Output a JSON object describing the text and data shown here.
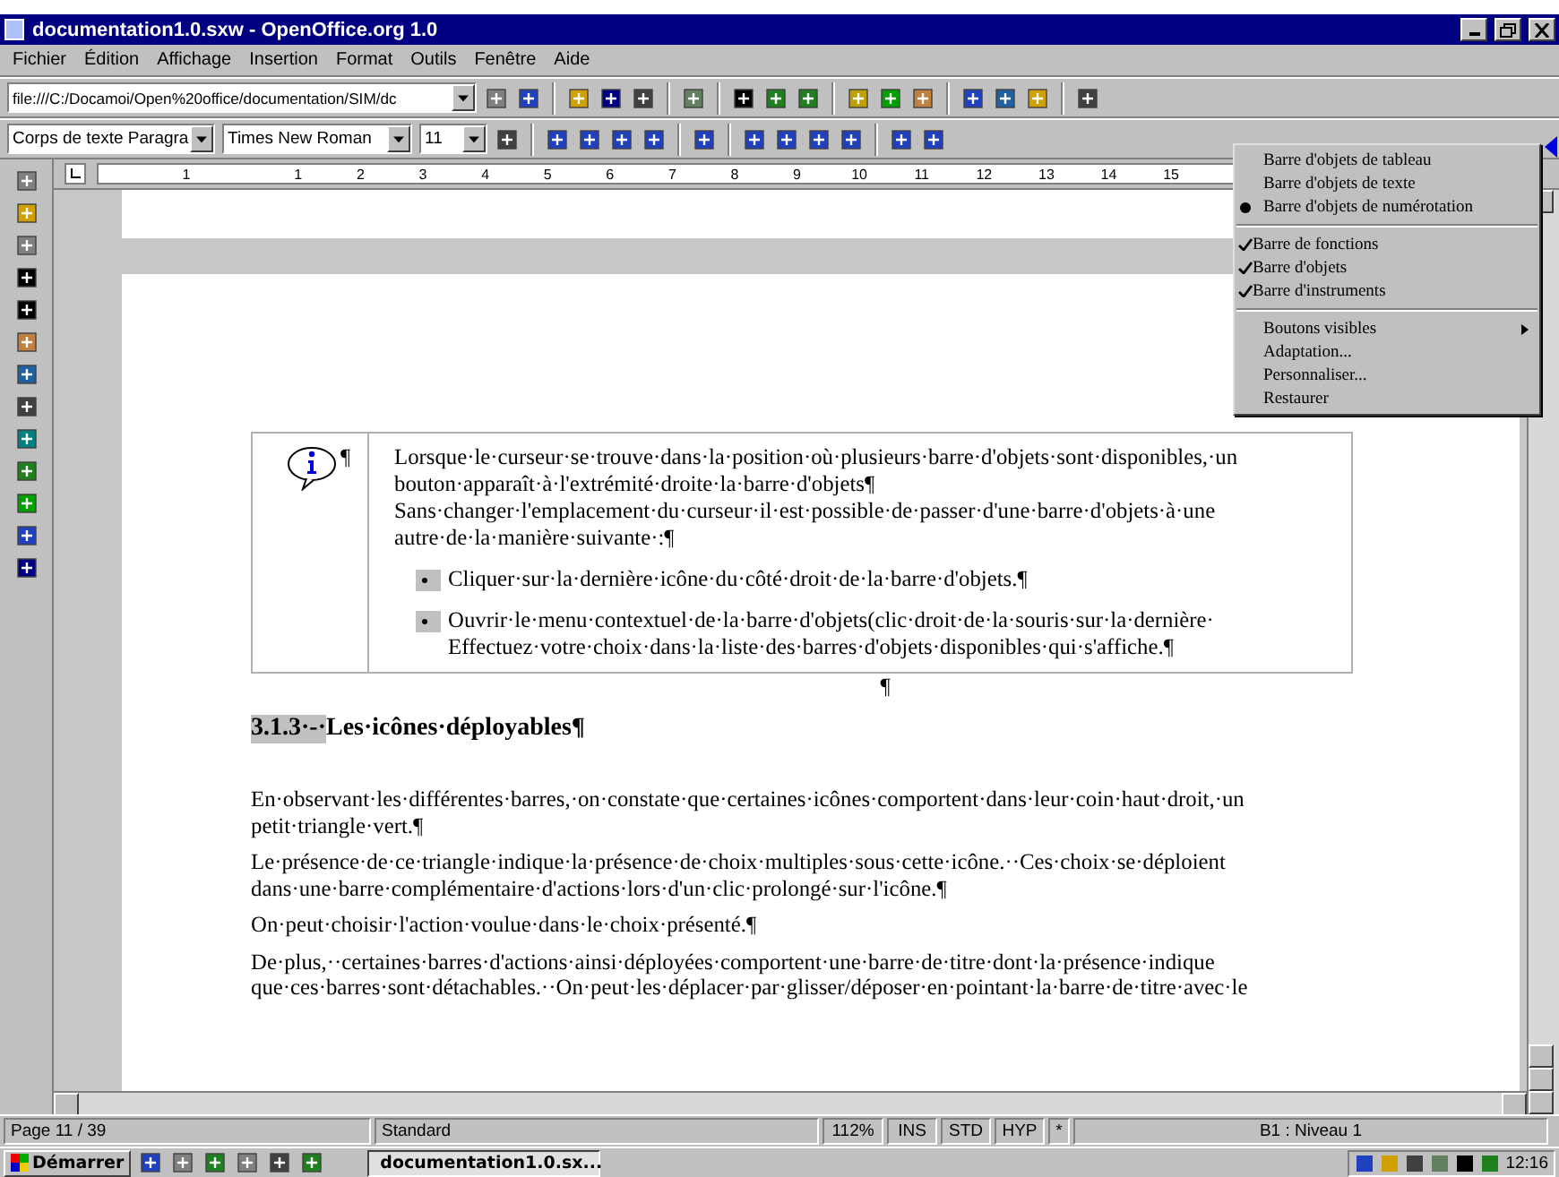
{
  "window": {
    "title": "documentation1.0.sxw - OpenOffice.org 1.0"
  },
  "menu_bar": [
    "Fichier",
    "Édition",
    "Affichage",
    "Insertion",
    "Format",
    "Outils",
    "Fenêtre",
    "Aide"
  ],
  "function_bar": {
    "url": "file:///C:/Docamoi/Open%20office/documentation/SIM/dc"
  },
  "object_bar": {
    "style": "Corps de texte Paragra",
    "font": "Times New Roman",
    "size": "11"
  },
  "ruler": {
    "labels": [
      "1",
      "1",
      "2",
      "3",
      "4",
      "5",
      "6",
      "7",
      "8",
      "9",
      "10",
      "11",
      "12",
      "13",
      "14",
      "15"
    ]
  },
  "note": {
    "paragraphs": [
      "Lorsque·le·curseur·se·trouve·dans·la·position·où·plusieurs·barre·d'objets·sont·disponibles,·un bouton·apparaît·à·l'extrémité·droite·la·barre·d'objets¶",
      "Sans·changer·l'emplacement·du·curseur·il·est·possible·de·passer·d'une·barre·d'objets·à·une autre·de·la·manière·suivante·:¶"
    ],
    "bullets": [
      "Cliquer·sur·la·dernière·icône·du·côté·droit·de·la·barre·d'objets.¶",
      "Ouvrir·le·menu·contextuel·de·la·barre·d'objets(clic·droit·de·la·souris·sur·la·dernière· Effectuez·votre·choix·dans·la·liste·des·barres·d'objets·disponibles·qui·s'affiche.¶"
    ],
    "info_mark": "¶"
  },
  "empty_paragraph": "¶",
  "heading": {
    "number": "3.1.3·-·",
    "title": "Les·icônes·déployables¶"
  },
  "paragraphs": [
    "En·observant·les·différentes·barres,·on·constate·que·certaines·icônes·comportent·dans·leur·coin·haut·droit,·un petit·triangle·vert.¶",
    "Le·présence·de·ce·triangle·indique·la·présence·de·choix·multiples·sous·cette·icône.··Ces·choix·se·déploient dans·une·barre·complémentaire·d'actions·lors·d'un·clic·prolongé·sur·l'icône.¶",
    "On·peut·choisir·l'action·voulue·dans·le·choix·présenté.¶",
    "De·plus,··certaines·barres·d'actions·ainsi·déployées·comportent·une·barre·de·titre·dont·la·présence·indique que·ces·barres·sont·détachables.··On·peut·les·déplacer·par·glisser/déposer·en·pointant·la·barre·de·titre·avec·le"
  ],
  "context_menu": {
    "sections": [
      [
        {
          "label": "Barre d'objets de tableau",
          "kind": "radio",
          "selected": false
        },
        {
          "label": "Barre d'objets de texte",
          "kind": "radio",
          "selected": false
        },
        {
          "label": "Barre d'objets de numérotation",
          "kind": "radio",
          "selected": true
        }
      ],
      [
        {
          "label": "Barre de fonctions",
          "kind": "check",
          "checked": true
        },
        {
          "label": "Barre d'objets",
          "kind": "check",
          "checked": true
        },
        {
          "label": "Barre d'instruments",
          "kind": "check",
          "checked": true
        }
      ],
      [
        {
          "label": "Boutons visibles",
          "kind": "submenu"
        },
        {
          "label": "Adaptation...",
          "kind": "item"
        },
        {
          "label": "Personnaliser...",
          "kind": "item"
        },
        {
          "label": "Restaurer",
          "kind": "item"
        }
      ]
    ]
  },
  "status_bar": {
    "page": "Page 11 / 39",
    "style": "Standard",
    "zoom": "112%",
    "insert": "INS",
    "selection": "STD",
    "hyperlink": "HYP",
    "modified": "*",
    "level": "B1 : Niveau 1"
  },
  "taskbar": {
    "start": "Démarrer",
    "task": "documentation1.0.sx...",
    "clock": "12:16"
  }
}
